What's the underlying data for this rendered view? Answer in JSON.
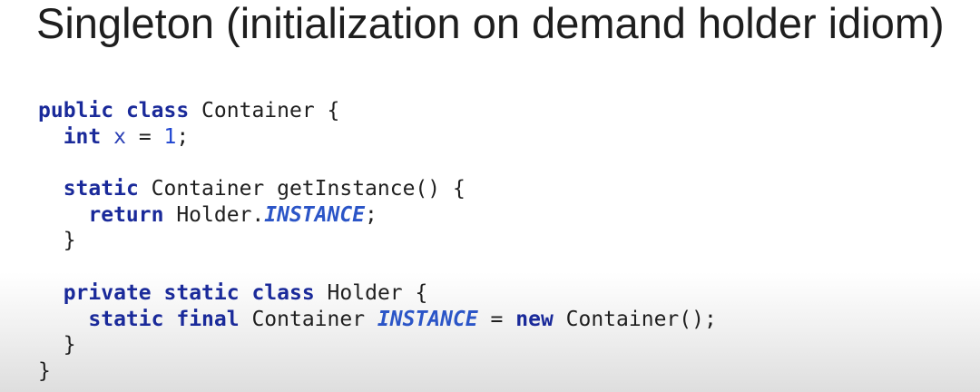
{
  "slide": {
    "title": "Singleton (initialization on demand holder idiom)"
  },
  "code": {
    "lines": [
      [
        {
          "t": "public",
          "k": "kw"
        },
        {
          "t": " ",
          "k": "id"
        },
        {
          "t": "class",
          "k": "kw"
        },
        {
          "t": " Container {",
          "k": "id"
        }
      ],
      [
        {
          "t": "  ",
          "k": "id"
        },
        {
          "t": "int",
          "k": "kw"
        },
        {
          "t": " ",
          "k": "id"
        },
        {
          "t": "x",
          "k": "field"
        },
        {
          "t": " = ",
          "k": "id"
        },
        {
          "t": "1",
          "k": "num"
        },
        {
          "t": ";",
          "k": "id"
        }
      ],
      [],
      [
        {
          "t": "  ",
          "k": "id"
        },
        {
          "t": "static",
          "k": "kw"
        },
        {
          "t": " Container getInstance() {",
          "k": "id"
        }
      ],
      [
        {
          "t": "    ",
          "k": "id"
        },
        {
          "t": "return",
          "k": "kw"
        },
        {
          "t": " Holder.",
          "k": "id"
        },
        {
          "t": "INSTANCE",
          "k": "const"
        },
        {
          "t": ";",
          "k": "id"
        }
      ],
      [
        {
          "t": "  }",
          "k": "id"
        }
      ],
      [],
      [
        {
          "t": "  ",
          "k": "id"
        },
        {
          "t": "private",
          "k": "kw"
        },
        {
          "t": " ",
          "k": "id"
        },
        {
          "t": "static",
          "k": "kw"
        },
        {
          "t": " ",
          "k": "id"
        },
        {
          "t": "class",
          "k": "kw"
        },
        {
          "t": " Holder {",
          "k": "id"
        }
      ],
      [
        {
          "t": "    ",
          "k": "id"
        },
        {
          "t": "static",
          "k": "kw"
        },
        {
          "t": " ",
          "k": "id"
        },
        {
          "t": "final",
          "k": "kw"
        },
        {
          "t": " Container ",
          "k": "id"
        },
        {
          "t": "INSTANCE",
          "k": "const"
        },
        {
          "t": " = ",
          "k": "id"
        },
        {
          "t": "new",
          "k": "kw"
        },
        {
          "t": " Container();",
          "k": "id"
        }
      ],
      [
        {
          "t": "  }",
          "k": "id"
        }
      ],
      [
        {
          "t": "}",
          "k": "id"
        }
      ]
    ]
  },
  "colors": {
    "title": "#1e1e1e",
    "keyword": "#1a2a9a",
    "identifier": "#1f1f1f",
    "field": "#2a3fb5",
    "number": "#1f45d1",
    "constant": "#2b55c7"
  }
}
